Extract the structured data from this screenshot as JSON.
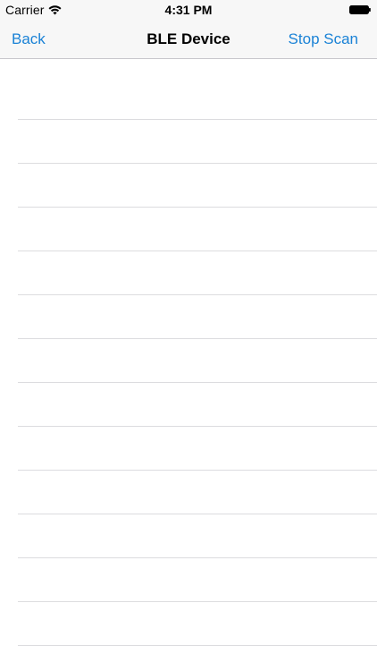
{
  "status_bar": {
    "carrier": "Carrier",
    "time": "4:31 PM",
    "wifi_icon": "wifi-icon",
    "battery_icon": "battery-icon"
  },
  "nav": {
    "back_label": "Back",
    "title": "BLE Device",
    "right_label": "Stop Scan",
    "accent_color": "#1a82d6"
  },
  "table": {
    "rows": [
      {},
      {},
      {},
      {},
      {},
      {},
      {},
      {},
      {},
      {},
      {},
      {},
      {}
    ]
  }
}
